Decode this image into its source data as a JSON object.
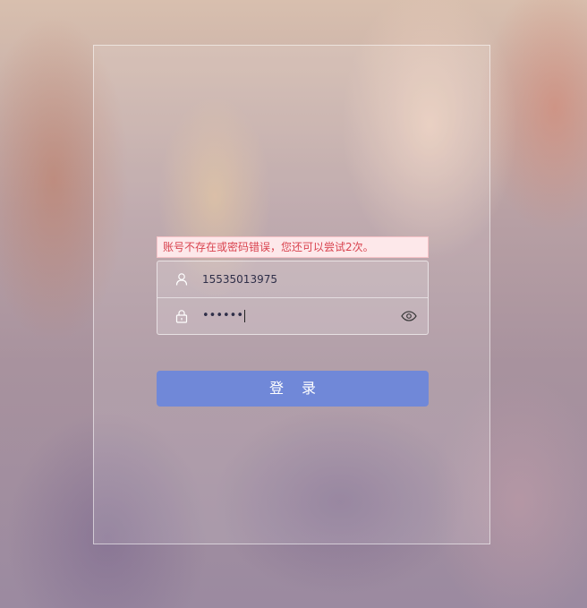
{
  "login": {
    "error_message": "账号不存在或密码错误，您还可以尝试2次。",
    "username_value": "15535013975",
    "password_masked": "••••••",
    "submit_label": "登录"
  },
  "icons": {
    "user": "user-icon",
    "lock": "lock-icon",
    "eye": "eye-icon"
  },
  "colors": {
    "error_text": "#d9434f",
    "error_bg": "#fde8ea",
    "button_bg": "#7088d8"
  }
}
